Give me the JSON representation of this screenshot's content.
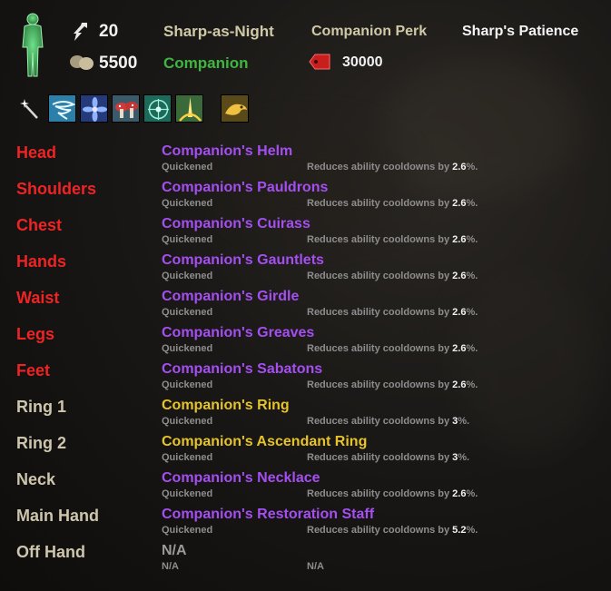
{
  "header": {
    "level": "20",
    "rapport": "5500",
    "companion_name": "Sharp-as-Night",
    "companion_type": "Companion",
    "perk_label": "Companion Perk",
    "perk_name": "Sharp's Patience",
    "currency_value": "30000"
  },
  "skills": [
    {
      "icon": "wand-icon"
    },
    {
      "icon": "whirlwind-skill-icon"
    },
    {
      "icon": "blue-flower-skill-icon"
    },
    {
      "icon": "mushroom-skill-icon"
    },
    {
      "icon": "rune-circle-skill-icon"
    },
    {
      "icon": "radiant-beam-skill-icon"
    },
    {
      "icon": "golden-creature-ultimate-icon"
    }
  ],
  "equipment": [
    {
      "slot": "Head",
      "item": "Companion's Helm",
      "trait": "Quickened",
      "desc_pre": "Reduces ability cooldowns by ",
      "value": "2.6",
      "desc_post": "%.",
      "slot_color": "red",
      "quality": "purple"
    },
    {
      "slot": "Shoulders",
      "item": "Companion's Pauldrons",
      "trait": "Quickened",
      "desc_pre": "Reduces ability cooldowns by ",
      "value": "2.6",
      "desc_post": "%.",
      "slot_color": "red",
      "quality": "purple"
    },
    {
      "slot": "Chest",
      "item": "Companion's Cuirass",
      "trait": "Quickened",
      "desc_pre": "Reduces ability cooldowns by ",
      "value": "2.6",
      "desc_post": "%.",
      "slot_color": "red",
      "quality": "purple"
    },
    {
      "slot": "Hands",
      "item": "Companion's Gauntlets",
      "trait": "Quickened",
      "desc_pre": "Reduces ability cooldowns by ",
      "value": "2.6",
      "desc_post": "%.",
      "slot_color": "red",
      "quality": "purple"
    },
    {
      "slot": "Waist",
      "item": "Companion's Girdle",
      "trait": "Quickened",
      "desc_pre": "Reduces ability cooldowns by ",
      "value": "2.6",
      "desc_post": "%.",
      "slot_color": "red",
      "quality": "purple"
    },
    {
      "slot": "Legs",
      "item": "Companion's Greaves",
      "trait": "Quickened",
      "desc_pre": "Reduces ability cooldowns by ",
      "value": "2.6",
      "desc_post": "%.",
      "slot_color": "red",
      "quality": "purple"
    },
    {
      "slot": "Feet",
      "item": "Companion's Sabatons",
      "trait": "Quickened",
      "desc_pre": "Reduces ability cooldowns by ",
      "value": "2.6",
      "desc_post": "%.",
      "slot_color": "red",
      "quality": "purple"
    },
    {
      "slot": "Ring 1",
      "item": "Companion's Ring",
      "trait": "Quickened",
      "desc_pre": "Reduces ability cooldowns by ",
      "value": "3",
      "desc_post": "%.",
      "slot_color": "tan",
      "quality": "gold"
    },
    {
      "slot": "Ring 2",
      "item": "Companion's Ascendant Ring",
      "trait": "Quickened",
      "desc_pre": "Reduces ability cooldowns by ",
      "value": "3",
      "desc_post": "%.",
      "slot_color": "tan",
      "quality": "gold"
    },
    {
      "slot": "Neck",
      "item": "Companion's Necklace",
      "trait": "Quickened",
      "desc_pre": "Reduces ability cooldowns by ",
      "value": "2.6",
      "desc_post": "%.",
      "slot_color": "tan",
      "quality": "purple"
    },
    {
      "slot": "Main Hand",
      "item": "Companion's Restoration Staff",
      "trait": "Quickened",
      "desc_pre": "Reduces ability cooldowns by ",
      "value": "5.2",
      "desc_post": "%.",
      "slot_color": "tan",
      "quality": "purple"
    },
    {
      "slot": "Off Hand",
      "item": "N/A",
      "trait": "N/A",
      "desc_pre": "N/A",
      "value": "",
      "desc_post": "",
      "slot_color": "tan",
      "quality": "gray"
    }
  ]
}
